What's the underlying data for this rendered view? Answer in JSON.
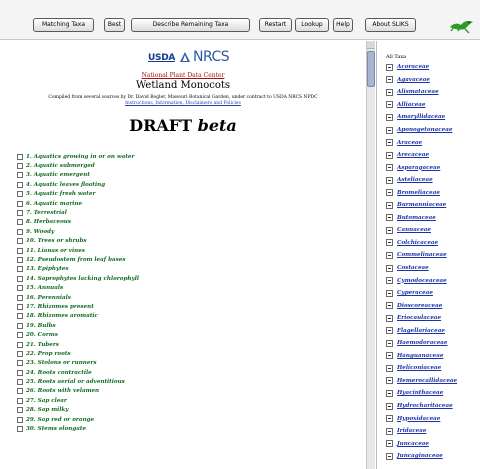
{
  "toolbar": {
    "buttons": [
      "Matching Taxa",
      "Best",
      "Describe Remaining Taxa",
      "Restart",
      "Lookup",
      "Help",
      "About SLIKS"
    ]
  },
  "header": {
    "usda": "USDA",
    "nrcs": "NRCS",
    "plant_data_center": "National Plant Data Center",
    "title": "Wetland Monocots",
    "compiled": "Compiled from several sources by Dr. David Bogler, Missouri Botanical Garden, under contract to USDA NRCS NPDC",
    "instructions": "Instructions, Information, Disclaimers and Policies",
    "draft": "DRAFT",
    "beta": "beta"
  },
  "characters": [
    "1. Aquatics growing in or on water",
    "2. Aquatic submerged",
    "3. Aquatic emergent",
    "4. Aquatic leaves floating",
    "5. Aquatic fresh water",
    "6. Aquatic marine",
    "7. Terrestrial",
    "8. Herbaceous",
    "9. Woody",
    "10. Trees or shrubs",
    "11. Lianas or vines",
    "12. Pseudostem from leaf bases",
    "13. Epiphytes",
    "14. Saprophytes lacking chlorophyll",
    "15. Annuals",
    "16. Perennials",
    "17. Rhizomes present",
    "18. Rhizomes aromatic",
    "19. Bulbs",
    "20. Corms",
    "21. Tubers",
    "22. Prop roots",
    "23. Stolons or runners",
    "24. Roots contractile",
    "25. Roots aerial or adventitious",
    "26. Roots with velamen",
    "27. Sap clear",
    "28. Sap milky",
    "29. Sap red or orange",
    "30. Stems elongate"
  ],
  "taxa_panel": {
    "heading": "All Taxa",
    "families": [
      "Acoraceae",
      "Agavaceae",
      "Alismataceae",
      "Alliaceae",
      "Amaryllidaceae",
      "Aponogetonaceae",
      "Araceae",
      "Arecaceae",
      "Asparagaceae",
      "Asteliaceae",
      "Bromeliaceae",
      "Burmanniaceae",
      "Butomaceae",
      "Cannaceae",
      "Colchicaceae",
      "Commelinaceae",
      "Costaceae",
      "Cymodoceaceae",
      "Cyperaceae",
      "Dioscoreaceae",
      "Eriocaulaceae",
      "Flagellariaceae",
      "Haemodoraceae",
      "Hanguanaceae",
      "Heliconiaceae",
      "Hemerocallidaceae",
      "Hyacinthaceae",
      "Hydrocharitaceae",
      "Hypoxidaceae",
      "Iridaceae",
      "Juncaceae",
      "Juncaginaceae"
    ]
  },
  "colors": {
    "character_text": "#0f6b21",
    "taxa_link": "#1b32a8",
    "nrcs_blue": "#2d5aa6"
  }
}
